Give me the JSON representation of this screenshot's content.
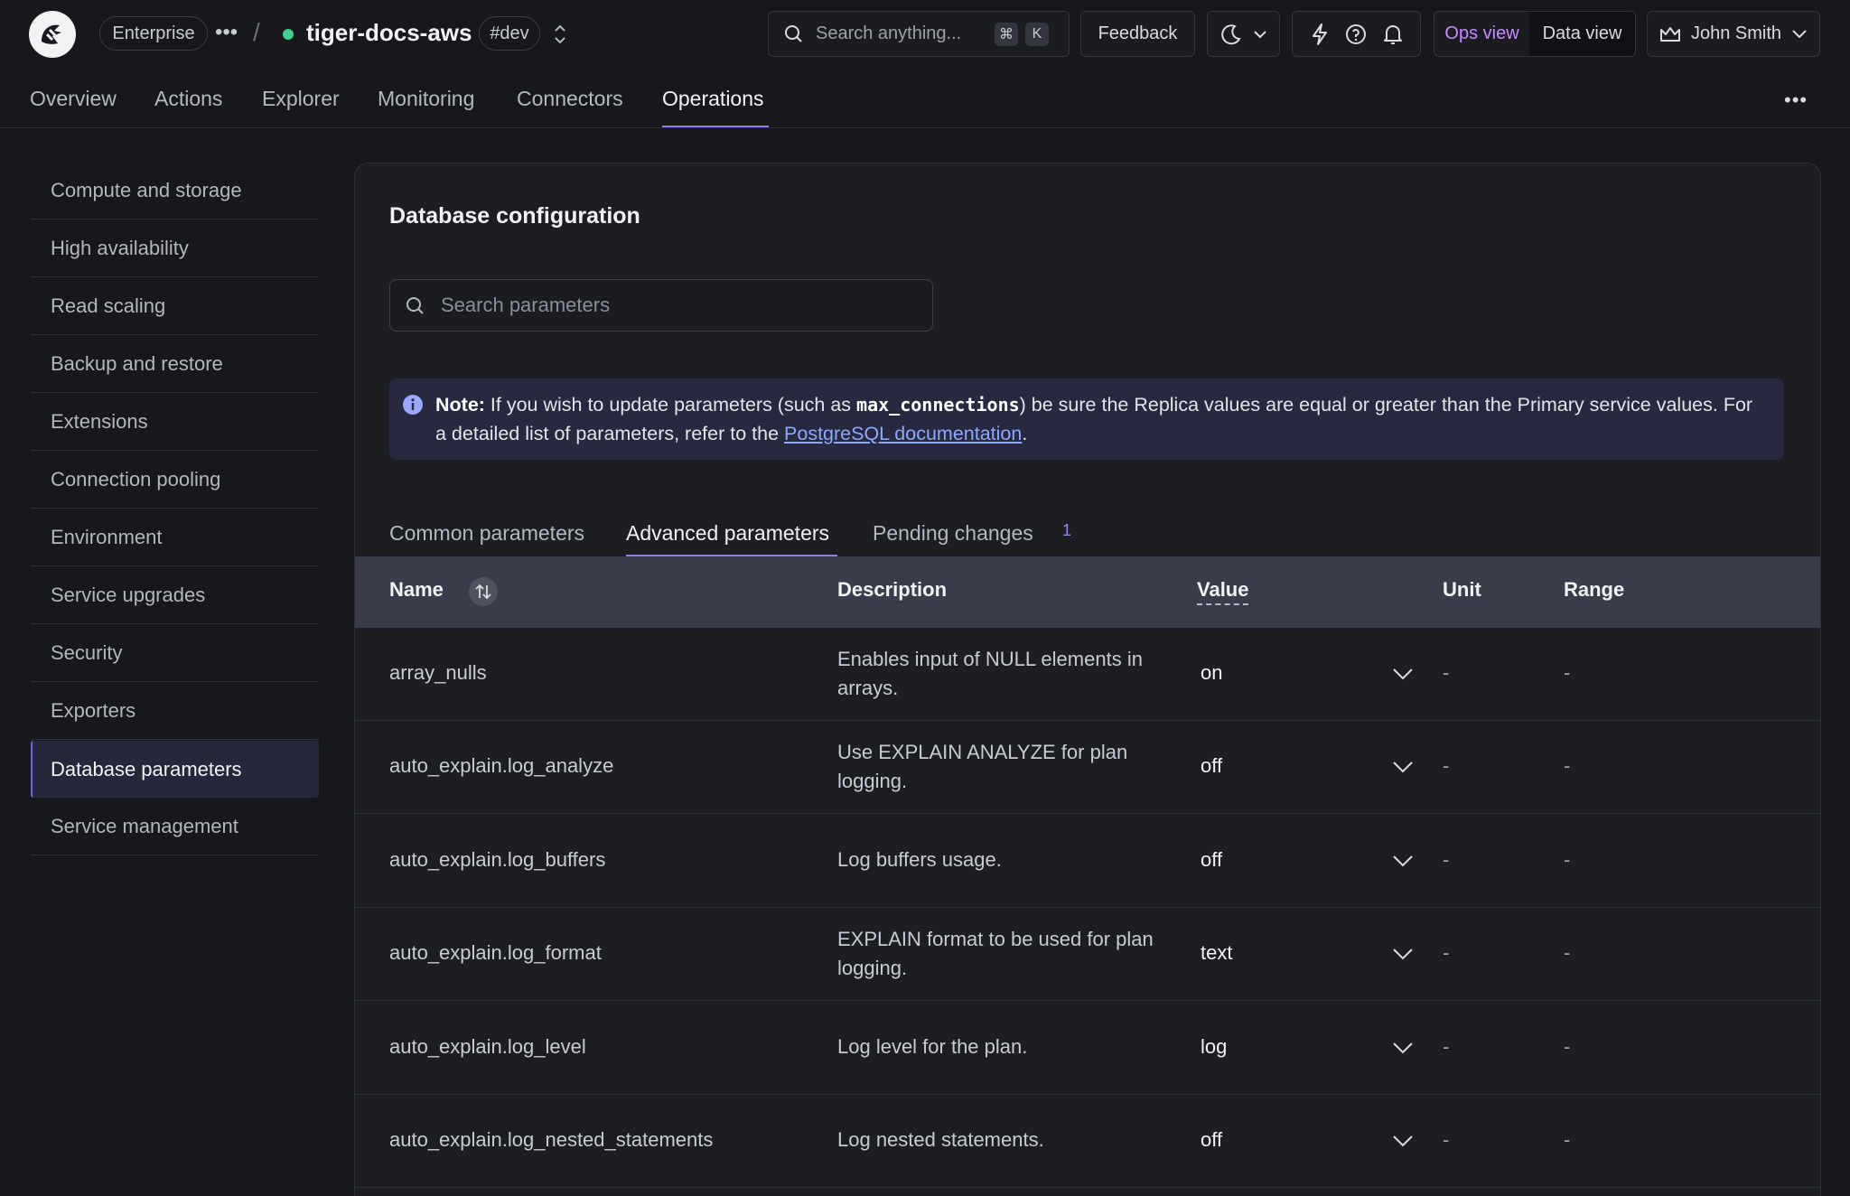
{
  "header": {
    "plan": "Enterprise",
    "separator": "/",
    "service_name": "tiger-docs-aws",
    "env_tag": "#dev",
    "search_placeholder": "Search anything...",
    "search_shortcut_mod": "⌘",
    "search_shortcut_key": "K",
    "feedback_label": "Feedback",
    "ops_view_label": "Ops view",
    "data_view_label": "Data view",
    "user_name": "John Smith"
  },
  "nav": {
    "tabs": [
      "Overview",
      "Actions",
      "Explorer",
      "Monitoring",
      "Connectors",
      "Operations"
    ],
    "active": "Operations"
  },
  "sidebar": {
    "items": [
      "Compute and storage",
      "High availability",
      "Read scaling",
      "Backup and restore",
      "Extensions",
      "Connection pooling",
      "Environment",
      "Service upgrades",
      "Security",
      "Exporters",
      "Database parameters",
      "Service management"
    ],
    "active": "Database parameters"
  },
  "main": {
    "title": "Database configuration",
    "search_placeholder": "Search parameters",
    "note": {
      "label": "Note:",
      "text_before": " If you wish to update parameters (such as ",
      "code": "max_connections",
      "text_after": ") be sure the Replica values are equal or greater than the Primary service values. For a detailed list of parameters, refer to the ",
      "link": "PostgreSQL documentation",
      "end": "."
    },
    "tabs": [
      "Common parameters",
      "Advanced parameters",
      "Pending changes"
    ],
    "active_tab": "Advanced parameters",
    "pending_count": "1",
    "table": {
      "columns": [
        "Name",
        "Description",
        "Value",
        "Unit",
        "Range"
      ],
      "rows": [
        {
          "name": "array_nulls",
          "description": "Enables input of NULL elements in arrays.",
          "value": "on",
          "unit": "-",
          "range": "-"
        },
        {
          "name": "auto_explain.log_analyze",
          "description": "Use EXPLAIN ANALYZE for plan logging.",
          "value": "off",
          "unit": "-",
          "range": "-"
        },
        {
          "name": "auto_explain.log_buffers",
          "description": "Log buffers usage.",
          "value": "off",
          "unit": "-",
          "range": "-"
        },
        {
          "name": "auto_explain.log_format",
          "description": "EXPLAIN format to be used for plan logging.",
          "value": "text",
          "unit": "-",
          "range": "-"
        },
        {
          "name": "auto_explain.log_level",
          "description": "Log level for the plan.",
          "value": "log",
          "unit": "-",
          "range": "-"
        },
        {
          "name": "auto_explain.log_nested_statements",
          "description": "Log nested statements.",
          "value": "off",
          "unit": "-",
          "range": "-"
        }
      ]
    }
  },
  "colors": {
    "accent": "#8f7cf7",
    "status_dot": "#3ecf8e",
    "ops_view": "#c48bff",
    "link": "#8fa8ff"
  }
}
